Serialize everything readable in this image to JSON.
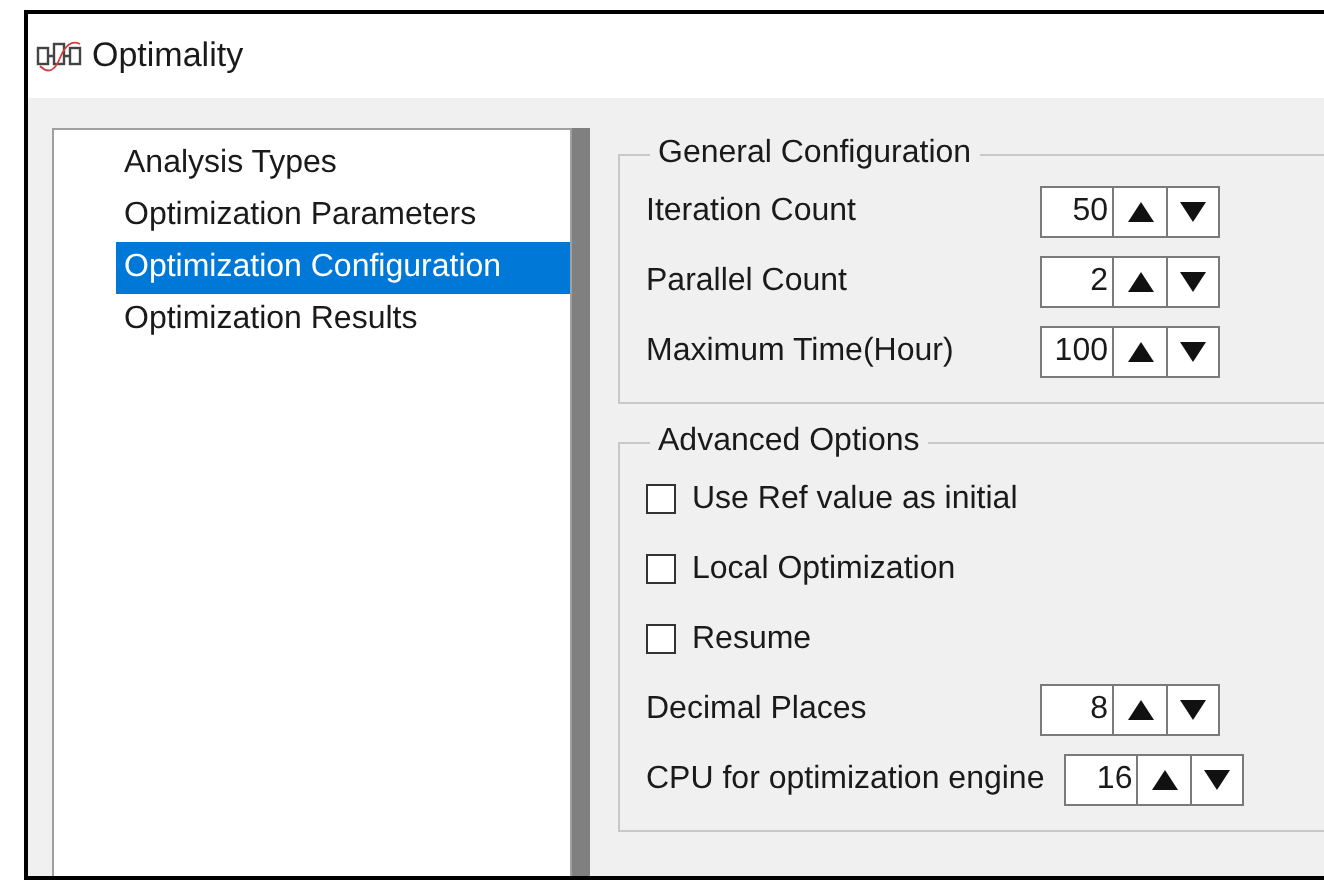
{
  "window": {
    "title": "Optimality"
  },
  "nav": {
    "items": [
      {
        "label": "Analysis Types",
        "selected": false
      },
      {
        "label": "Optimization Parameters",
        "selected": false
      },
      {
        "label": "Optimization Configuration",
        "selected": true
      },
      {
        "label": "Optimization Results",
        "selected": false
      }
    ]
  },
  "general": {
    "title": "General Configuration",
    "fields": [
      {
        "label": "Iteration Count",
        "value": "50"
      },
      {
        "label": "Parallel Count",
        "value": "2"
      },
      {
        "label": "Maximum Time(Hour)",
        "value": "100"
      }
    ]
  },
  "advanced": {
    "title": "Advanced Options",
    "options": [
      {
        "label": "Use Ref value as initial",
        "checked": false
      },
      {
        "label": "Local Optimization",
        "checked": false
      },
      {
        "label": "Resume",
        "checked": false
      }
    ],
    "fields": [
      {
        "label": "Decimal Places",
        "value": "8"
      },
      {
        "label": "CPU for optimization engine",
        "value": "16"
      }
    ]
  }
}
